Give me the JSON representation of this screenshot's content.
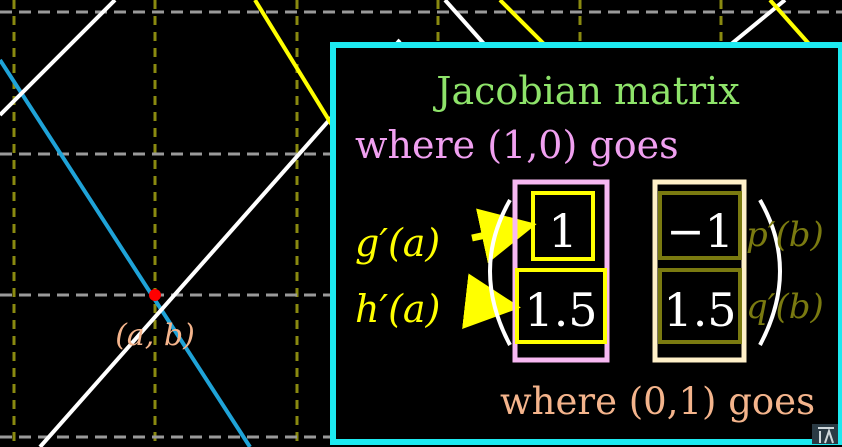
{
  "panel": {
    "title": "Jacobian matrix",
    "col1_caption": "where (1,0) goes",
    "col2_caption": "where (0,1) goes"
  },
  "point_label": "(a, b)",
  "left_labels": {
    "g_prime": "g′(a)",
    "h_prime": "h′(a)"
  },
  "right_labels": {
    "p_prime": "p′(b)",
    "q_prime": "q′(b)"
  },
  "matrix": {
    "r1c1": "1",
    "r2c1": "1.5",
    "r1c2": "−1",
    "r2c2": "1.5"
  },
  "colors": {
    "background": "#000000",
    "panel_border": "#1de9f0",
    "title_green": "#8ee36a",
    "caption_pink": "#f0a0f0",
    "caption_peach": "#f4b48c",
    "yellow": "#ffff00",
    "olive": "#7a7a10",
    "col2_border": "#fff0c8",
    "blue_line": "#1fa3d8",
    "point_red": "#ff0000"
  }
}
